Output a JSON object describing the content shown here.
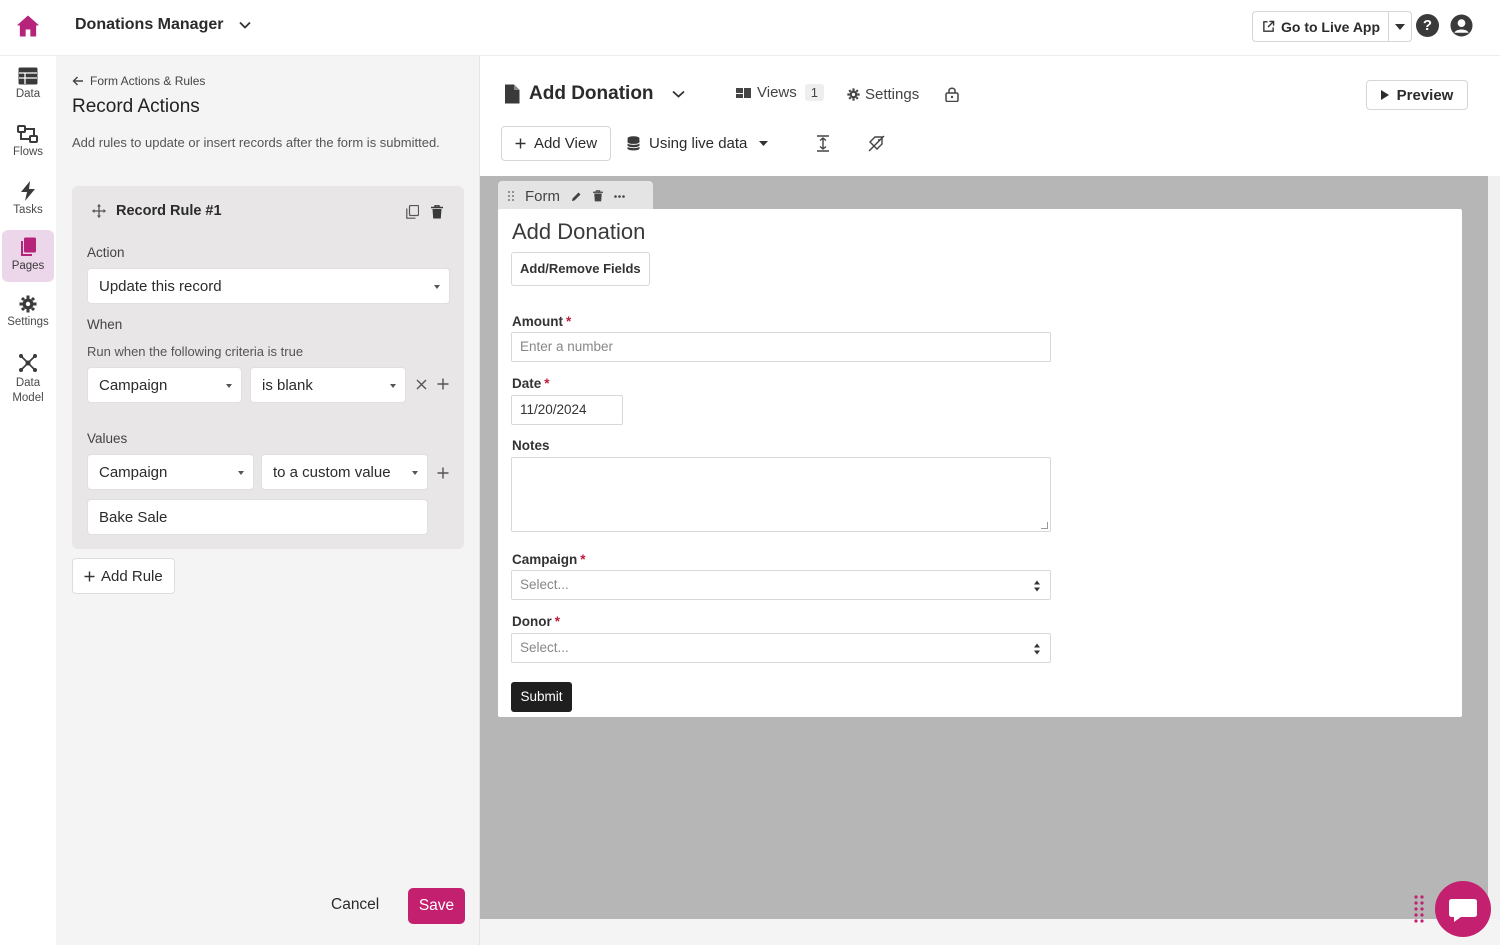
{
  "topbar": {
    "app_title": "Donations Manager",
    "live_app_label": "Go to Live App",
    "help_glyph": "?"
  },
  "nav": [
    {
      "label": "Data",
      "icon": "table-icon"
    },
    {
      "label": "Flows",
      "icon": "flows-icon"
    },
    {
      "label": "Tasks",
      "icon": "lightning-icon"
    },
    {
      "label": "Pages",
      "icon": "pages-icon",
      "active": true
    },
    {
      "label": "Settings",
      "icon": "gear-icon"
    },
    {
      "label": "Data Model",
      "icon": "data-model-icon"
    }
  ],
  "panel": {
    "back_label": "Form Actions & Rules",
    "title": "Record Actions",
    "description": "Add rules to update or insert records after the form is submitted.",
    "rule": {
      "title": "Record Rule #1",
      "action_label": "Action",
      "action_value": "Update this record",
      "when_label": "When",
      "when_sub": "Run when the following criteria is true",
      "criteria_field": "Campaign",
      "criteria_op": "is blank",
      "values_label": "Values",
      "value_field": "Campaign",
      "value_mode": "to a custom value",
      "custom_value": "Bake Sale"
    },
    "add_rule_label": "Add Rule",
    "cancel_label": "Cancel",
    "save_label": "Save"
  },
  "editor": {
    "page_name": "Add Donation",
    "views_label": "Views",
    "views_count": "1",
    "settings_label": "Settings",
    "preview_label": "Preview",
    "add_view_label": "Add View",
    "data_source_label": "Using live data"
  },
  "form": {
    "tab_label": "Form",
    "title": "Add Donation",
    "add_remove_label": "Add/Remove Fields",
    "amount_label": "Amount",
    "amount_placeholder": "Enter a number",
    "date_label": "Date",
    "date_value": "11/20/2024",
    "notes_label": "Notes",
    "campaign_label": "Campaign",
    "campaign_placeholder": "Select...",
    "donor_label": "Donor",
    "donor_placeholder": "Select...",
    "submit_label": "Submit",
    "required_mark": "*"
  },
  "colors": {
    "brand": "#c3206f",
    "active_nav_bg": "#ecd6ea",
    "canvas_bg": "#b6b6b6"
  }
}
